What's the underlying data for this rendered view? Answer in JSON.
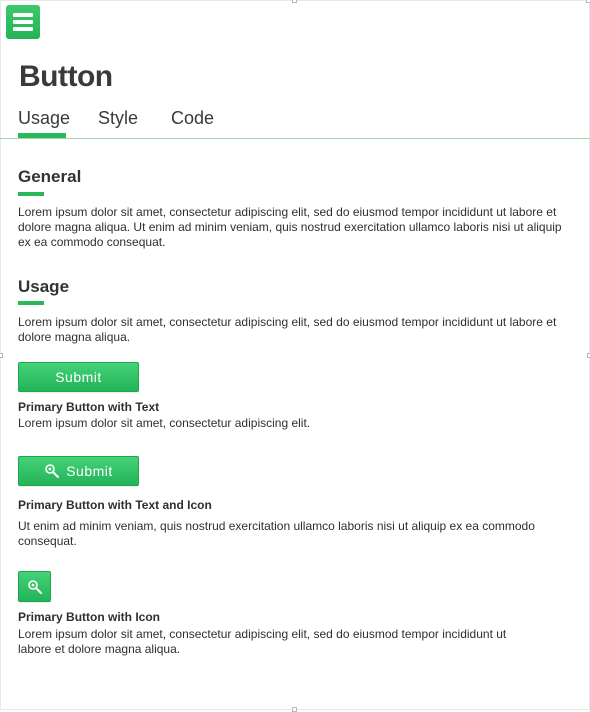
{
  "header": {
    "title": "Button"
  },
  "tabs": [
    {
      "label": "Usage",
      "active": true
    },
    {
      "label": "Style",
      "active": false
    },
    {
      "label": "Code",
      "active": false
    }
  ],
  "general": {
    "title": "General",
    "text": "Lorem ipsum dolor sit amet, consectetur adipiscing elit, sed do eiusmod tempor incididunt ut labore et dolore magna aliqua. Ut enim ad minim veniam, quis nostrud exercitation ullamco laboris nisi ut aliquip ex ea commodo consequat."
  },
  "usage": {
    "title": "Usage",
    "text": "Lorem ipsum dolor sit amet, consectetur adipiscing elit, sed do eiusmod tempor incididunt ut labore et dolore magna aliqua."
  },
  "examples": {
    "text_button": {
      "label": "Submit",
      "caption": "Primary Button with Text",
      "description": "Lorem ipsum dolor sit amet, consectetur adipiscing elit."
    },
    "text_icon_button": {
      "label": "Submit",
      "icon": "search-icon",
      "caption": "Primary Button with Text and Icon",
      "description": "Ut enim ad minim veniam, quis nostrud exercitation ullamco laboris nisi ut aliquip ex ea commodo consequat."
    },
    "icon_button": {
      "icon": "search-icon",
      "caption": "Primary Button with Icon",
      "description": "Lorem ipsum dolor sit amet, consectetur adipiscing elit, sed do eiusmod tempor incididunt ut labore et dolore magna aliqua."
    }
  },
  "colors": {
    "accent": "#28b85a",
    "button_top": "#45d278",
    "button_bottom": "#23b358"
  },
  "icons": {
    "menu": "hamburger-menu-icon"
  }
}
